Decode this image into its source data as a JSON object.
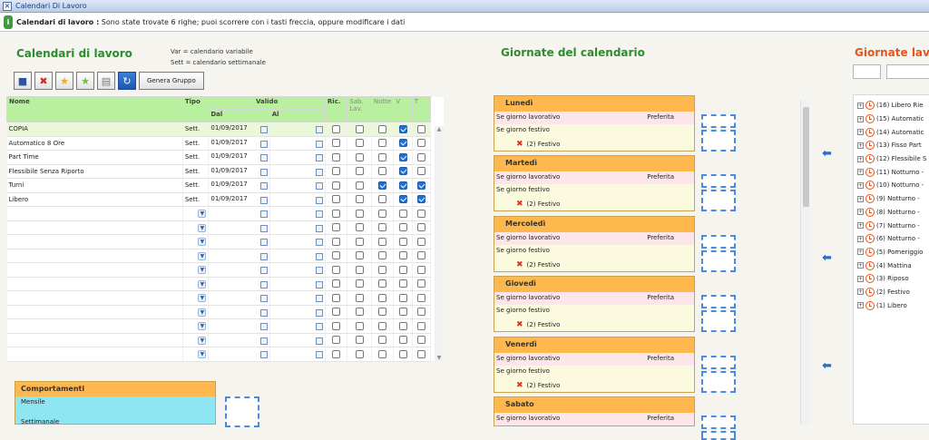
{
  "window": {
    "title": "Calendari Di Lavoro"
  },
  "message": {
    "label": "Calendari di lavoro :",
    "text": " Sono state trovate 6 righe; puoi scorrere con i tasti freccia, oppure modificare i dati"
  },
  "left": {
    "title": "Calendari di lavoro",
    "legend_var": "Var = calendario variabile",
    "legend_sett": "Sett = calendario settimanale",
    "toolbar": {
      "genera_label": "Genera Gruppo"
    },
    "grid": {
      "headers": {
        "nome": "Nome",
        "tipo": "Tipo",
        "valido": "Valido",
        "dal": "Dal",
        "al": "Al",
        "ric": "Ric.",
        "sablav": "Sab. Lav.",
        "notte": "Notte",
        "v": "V",
        "t": "T"
      },
      "rows": [
        {
          "nome": "COPIA",
          "tipo": "Sett.",
          "dal": "01/09/2017",
          "al": "",
          "ric": false,
          "sab": false,
          "notte": false,
          "v": true,
          "t": false
        },
        {
          "nome": "Automatico 8 Ore",
          "tipo": "Sett.",
          "dal": "01/09/2017",
          "al": "",
          "ric": false,
          "sab": false,
          "notte": false,
          "v": true,
          "t": false
        },
        {
          "nome": "Part Time",
          "tipo": "Sett.",
          "dal": "01/09/2017",
          "al": "",
          "ric": false,
          "sab": false,
          "notte": false,
          "v": true,
          "t": false
        },
        {
          "nome": "Flessibile Senza Riporto",
          "tipo": "Sett.",
          "dal": "01/09/2017",
          "al": "",
          "ric": false,
          "sab": false,
          "notte": false,
          "v": true,
          "t": false
        },
        {
          "nome": "Turni",
          "tipo": "Sett.",
          "dal": "01/09/2017",
          "al": "",
          "ric": false,
          "sab": false,
          "notte": true,
          "v": true,
          "t": true
        },
        {
          "nome": "Libero",
          "tipo": "Sett.",
          "dal": "01/09/2017",
          "al": "",
          "ric": false,
          "sab": false,
          "notte": false,
          "v": true,
          "t": true
        }
      ],
      "empty_rows": 11
    },
    "comportamenti": {
      "title": "Comportamenti",
      "item1": "Mensile",
      "item2": "Settimanale"
    }
  },
  "middle": {
    "title": "Giornate del calendario",
    "days": [
      {
        "name": "Lunedì",
        "lav": "Se giorno lavorativo",
        "pref": "Preferita",
        "fest": "Se giorno festivo",
        "fest_item": "(2) Festivo"
      },
      {
        "name": "Martedì",
        "lav": "Se giorno lavorativo",
        "pref": "Preferita",
        "fest": "Se giorno festivo",
        "fest_item": "(2) Festivo"
      },
      {
        "name": "Mercoledì",
        "lav": "Se giorno lavorativo",
        "pref": "Preferita",
        "fest": "Se giorno festivo",
        "fest_item": "(2) Festivo"
      },
      {
        "name": "Giovedì",
        "lav": "Se giorno lavorativo",
        "pref": "Preferita",
        "fest": "Se giorno festivo",
        "fest_item": "(2) Festivo"
      },
      {
        "name": "Venerdì",
        "lav": "Se giorno lavorativo",
        "pref": "Preferita",
        "fest": "Se giorno festivo",
        "fest_item": "(2) Festivo"
      },
      {
        "name": "Sabato",
        "lav": "Se giorno lavorativo",
        "pref": "Preferita",
        "fest": "",
        "fest_item": ""
      }
    ]
  },
  "right": {
    "title": "Giornate lavo",
    "tree": [
      "(16) Libero Rie",
      "(15) Automatic",
      "(14) Automatic",
      "(13) Fisso Part",
      "(12) Flessibile S",
      "(11) Notturno -",
      "(10) Notturno -",
      "(9) Notturno -",
      "(8) Notturno -",
      "(7) Notturno -",
      "(6) Notturno -",
      "(5) Pomeriggio",
      "(4) Mattina",
      "(3) Riposo",
      "(2) Festivo",
      "(1) Libero"
    ]
  },
  "colors": {
    "accent_green": "#2e8b2e",
    "accent_orange": "#e8541a",
    "header_green": "#b8f0a0",
    "card_orange": "#ffb84e"
  }
}
